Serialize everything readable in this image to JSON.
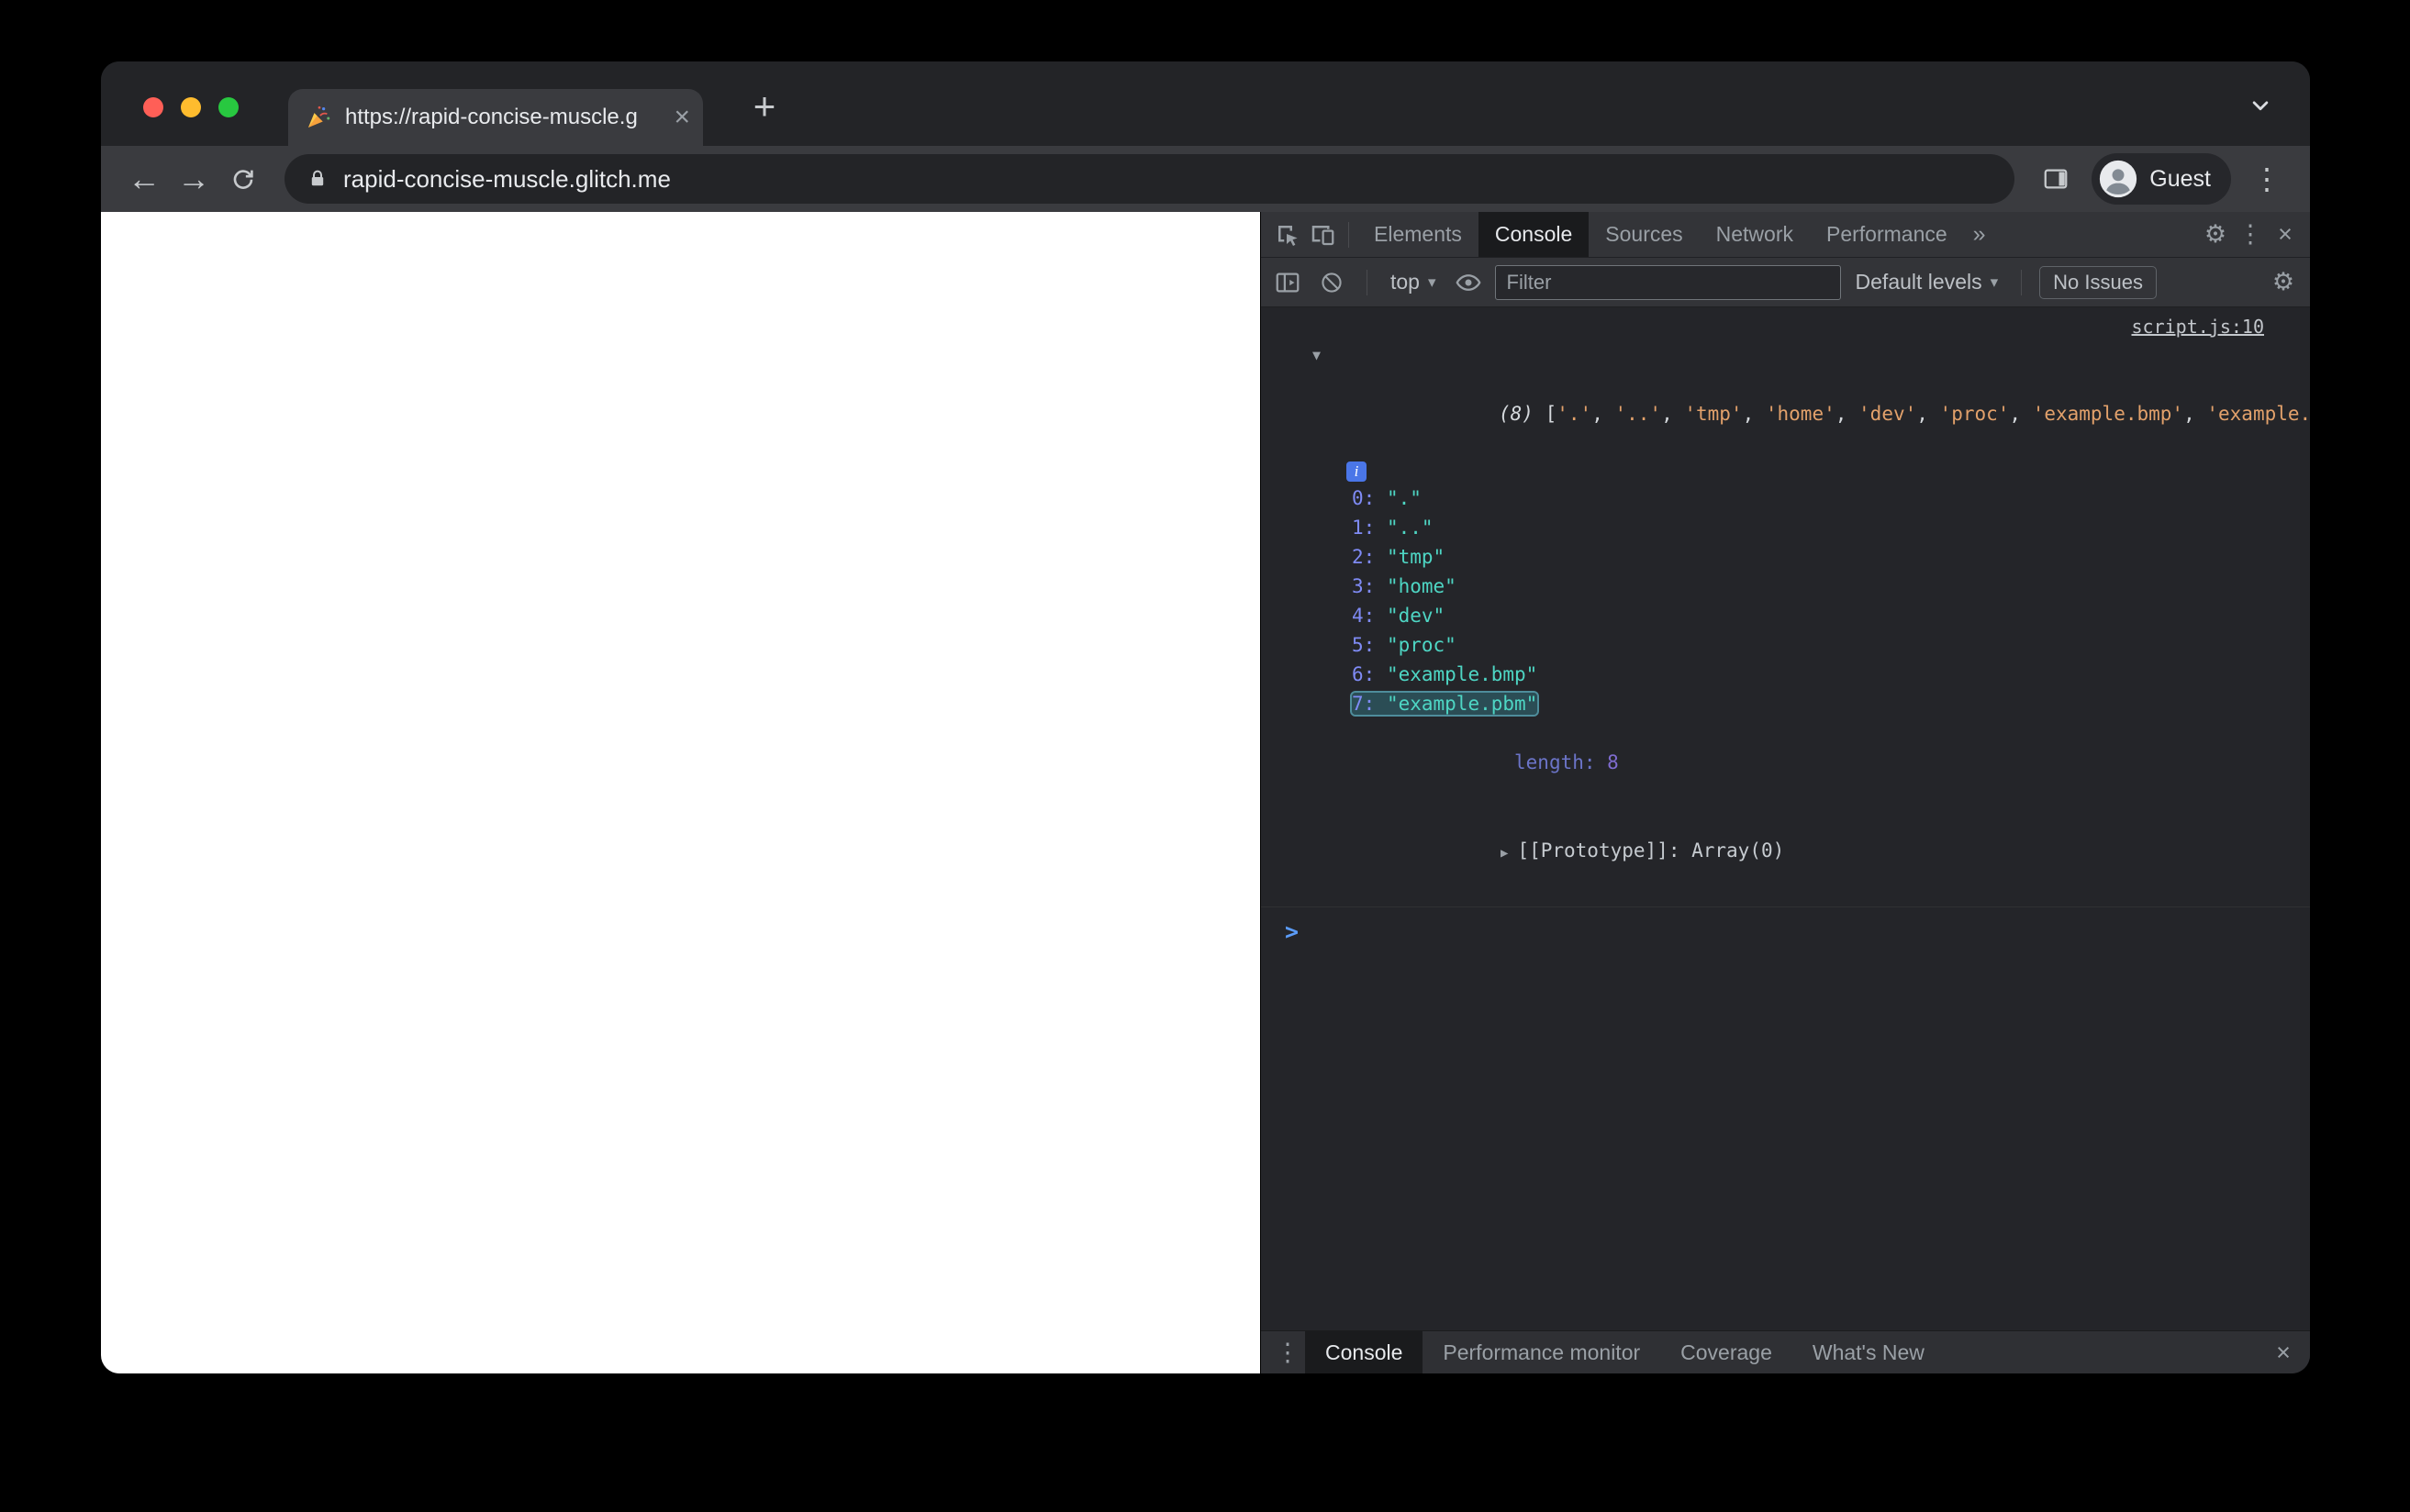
{
  "window": {
    "tab_title": "https://rapid-concise-muscle.g",
    "url": "rapid-concise-muscle.glitch.me",
    "guest_label": "Guest"
  },
  "icons": {
    "back": "←",
    "forward": "→",
    "plus": "+",
    "close": "×",
    "kebab": "⋮",
    "more": "»",
    "gear": "⚙",
    "caret_down": "▾",
    "tri_down": "▼",
    "tri_right": "▶",
    "prompt": ">",
    "info": "i"
  },
  "devtools": {
    "tabs": [
      "Elements",
      "Console",
      "Sources",
      "Network",
      "Performance"
    ],
    "active_tab": "Console",
    "toolbar": {
      "context_selector": "top",
      "filter_placeholder": "Filter",
      "levels_label": "Default levels",
      "issues_label": "No Issues"
    },
    "console": {
      "source_link": "script.js:10",
      "preview_parts": [
        {
          "text": "(8) ",
          "type": "meta"
        },
        {
          "text": "[",
          "type": "punct"
        },
        {
          "text": "'.'",
          "type": "string"
        },
        {
          "text": ", ",
          "type": "punct"
        },
        {
          "text": "'..'",
          "type": "string"
        },
        {
          "text": ", ",
          "type": "punct"
        },
        {
          "text": "'tmp'",
          "type": "string"
        },
        {
          "text": ", ",
          "type": "punct"
        },
        {
          "text": "'home'",
          "type": "string"
        },
        {
          "text": ", ",
          "type": "punct"
        },
        {
          "text": "'dev'",
          "type": "string"
        },
        {
          "text": ", ",
          "type": "punct"
        },
        {
          "text": "'proc'",
          "type": "string"
        },
        {
          "text": ", ",
          "type": "punct"
        },
        {
          "text": "'example.bmp'",
          "type": "string"
        },
        {
          "text": ", ",
          "type": "punct"
        },
        {
          "text": "'example.pbm'",
          "type": "string"
        },
        {
          "text": "]",
          "type": "punct"
        }
      ],
      "items": [
        {
          "index": "0",
          "value": "\".\"",
          "highlighted": false
        },
        {
          "index": "1",
          "value": "\"..\"",
          "highlighted": false
        },
        {
          "index": "2",
          "value": "\"tmp\"",
          "highlighted": false
        },
        {
          "index": "3",
          "value": "\"home\"",
          "highlighted": false
        },
        {
          "index": "4",
          "value": "\"dev\"",
          "highlighted": false
        },
        {
          "index": "5",
          "value": "\"proc\"",
          "highlighted": false
        },
        {
          "index": "6",
          "value": "\"example.bmp\"",
          "highlighted": false
        },
        {
          "index": "7",
          "value": "\"example.pbm\"",
          "highlighted": true
        }
      ],
      "length_label": "length: ",
      "length_value": "8",
      "prototype_label": "[[Prototype]]: ",
      "prototype_value": "Array(0)"
    },
    "drawer": {
      "tabs": [
        "Console",
        "Performance monitor",
        "Coverage",
        "What's New"
      ],
      "active_tab": "Console"
    }
  },
  "colors": {
    "traffic_red": "#ff5f57",
    "traffic_yellow": "#febc2e",
    "traffic_green": "#28c840",
    "string_preview": "#e2a16b",
    "string_value": "#4ed6c4",
    "index_blue": "#7f8bf5",
    "number_purple": "#9980ff",
    "prompt_blue": "#5b9cf8",
    "link_gray": "#c3c7cc",
    "info_badge_blue": "#4a76e8",
    "highlight_border": "#4e8d9b",
    "highlight_bg": "#2b4d55"
  }
}
